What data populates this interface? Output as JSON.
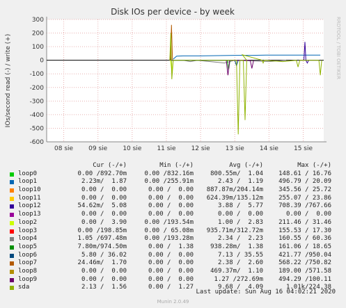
{
  "chart_data": {
    "type": "line",
    "title": "Disk IOs per device - by week",
    "ylabel": "IOs/second read (-) / write (+)",
    "side_label": "RRDTOOL / TOBI OETIKER",
    "ylim": [
      -600,
      300
    ],
    "yticks": [
      300,
      200,
      100,
      0,
      -100,
      -200,
      -300,
      -400,
      -500,
      -600
    ],
    "xlim": [
      0,
      8.1
    ],
    "xticks": [
      {
        "value": 0.5,
        "label": "08 sie"
      },
      {
        "value": 1.5,
        "label": "09 sie"
      },
      {
        "value": 2.5,
        "label": "10 sie"
      },
      {
        "value": 3.5,
        "label": "11 sie"
      },
      {
        "value": 4.5,
        "label": "12 sie"
      },
      {
        "value": 5.5,
        "label": "13 sie"
      },
      {
        "value": 6.5,
        "label": "14 sie"
      },
      {
        "value": 7.5,
        "label": "15 sie"
      }
    ],
    "grid": true,
    "series": [
      {
        "name": "loop0",
        "color": "#00cc00",
        "points": []
      },
      {
        "name": "loop1",
        "color": "#0066b3",
        "points": [
          [
            3.7,
            8
          ],
          [
            3.8,
            30
          ],
          [
            4.0,
            32
          ],
          [
            4.5,
            32
          ],
          [
            5.0,
            34
          ],
          [
            5.5,
            36
          ],
          [
            6.0,
            36
          ],
          [
            6.5,
            38
          ],
          [
            7.0,
            38
          ],
          [
            7.5,
            38
          ],
          [
            8.0,
            38
          ]
        ]
      },
      {
        "name": "loop10",
        "color": "#ff8000",
        "points": []
      },
      {
        "name": "loop11",
        "color": "#ffcc00",
        "points": []
      },
      {
        "name": "loop12",
        "color": "#330099",
        "points": [
          [
            7.52,
            0
          ],
          [
            7.55,
            135
          ],
          [
            7.58,
            0
          ],
          [
            7.62,
            -20
          ],
          [
            7.66,
            0
          ]
        ]
      },
      {
        "name": "loop13",
        "color": "#990099",
        "points": []
      },
      {
        "name": "loop2",
        "color": "#ccff00",
        "points": [
          [
            3.62,
            0
          ],
          [
            3.66,
            -80
          ],
          [
            3.7,
            0
          ]
        ]
      },
      {
        "name": "loop3",
        "color": "#ff0000",
        "points": []
      },
      {
        "name": "loop4",
        "color": "#808080",
        "points": [
          [
            4.0,
            0
          ],
          [
            4.2,
            -10
          ],
          [
            4.4,
            0
          ],
          [
            5.2,
            -20
          ],
          [
            5.5,
            0
          ],
          [
            6.5,
            -10
          ],
          [
            7.0,
            0
          ]
        ]
      },
      {
        "name": "loop5",
        "color": "#008f00",
        "points": [
          [
            5.28,
            0
          ],
          [
            5.32,
            -70
          ],
          [
            5.36,
            0
          ]
        ]
      },
      {
        "name": "loop6",
        "color": "#00487d",
        "points": [
          [
            3.6,
            0
          ],
          [
            3.62,
            30
          ],
          [
            3.64,
            0
          ],
          [
            5.5,
            0
          ],
          [
            5.55,
            -40
          ],
          [
            5.6,
            0
          ]
        ]
      },
      {
        "name": "loop7",
        "color": "#b35a00",
        "points": [
          [
            3.62,
            0
          ],
          [
            3.65,
            260
          ],
          [
            3.68,
            0
          ]
        ]
      },
      {
        "name": "loop8",
        "color": "#b38f00",
        "points": []
      },
      {
        "name": "loop9",
        "color": "#6b006b",
        "points": [
          [
            5.25,
            0
          ],
          [
            5.3,
            -110
          ],
          [
            5.35,
            0
          ],
          [
            5.95,
            0
          ],
          [
            6.0,
            -60
          ],
          [
            6.05,
            0
          ]
        ]
      },
      {
        "name": "sda",
        "color": "#8fb300",
        "points": [
          [
            3.6,
            0
          ],
          [
            3.63,
            200
          ],
          [
            3.66,
            -140
          ],
          [
            3.7,
            0
          ],
          [
            5.55,
            0
          ],
          [
            5.6,
            -545
          ],
          [
            5.65,
            0
          ],
          [
            5.75,
            0
          ],
          [
            5.8,
            -440
          ],
          [
            5.85,
            0
          ],
          [
            5.72,
            40
          ],
          [
            6.3,
            0
          ],
          [
            6.33,
            -20
          ],
          [
            6.36,
            0
          ],
          [
            6.9,
            -10
          ],
          [
            7.3,
            0
          ],
          [
            7.35,
            -50
          ],
          [
            7.4,
            0
          ],
          [
            7.96,
            0
          ],
          [
            8.0,
            -110
          ],
          [
            8.04,
            0
          ]
        ]
      }
    ],
    "legend_headers": [
      "Cur (-/+)",
      "Min (-/+)",
      "Avg (-/+)",
      "Max (-/+)"
    ],
    "legend": [
      {
        "name": "loop0",
        "cur": "0.00 /892.70m",
        "min": "0.00 /832.16m",
        "avg": "800.55m/  1.04",
        "max": "148.61 / 16.76"
      },
      {
        "name": "loop1",
        "cur": "2.23m/  1.87",
        "min": "0.00 /255.91m",
        "avg": "2.43 /  1.19",
        "max": "496.79 / 20.09"
      },
      {
        "name": "loop10",
        "cur": "0.00 /  0.00",
        "min": "0.00 /  0.00",
        "avg": "887.87m/204.14m",
        "max": "345.56 / 25.72"
      },
      {
        "name": "loop11",
        "cur": "0.00 /  0.00",
        "min": "0.00 /  0.00",
        "avg": "624.39m/135.12m",
        "max": "255.07 / 23.86"
      },
      {
        "name": "loop12",
        "cur": "54.62m/  5.08",
        "min": "0.00 /  0.00",
        "avg": "3.88 /  5.77",
        "max": "708.39 /767.66"
      },
      {
        "name": "loop13",
        "cur": "0.00 /  0.00",
        "min": "0.00 /  0.00",
        "avg": "0.00 /  0.00",
        "max": "0.00 /  0.00"
      },
      {
        "name": "loop2",
        "cur": "0.00 /  3.90",
        "min": "0.00 /193.54m",
        "avg": "1.00 /  2.83",
        "max": "211.46 / 31.46"
      },
      {
        "name": "loop3",
        "cur": "0.00 /198.85m",
        "min": "0.00 / 65.08m",
        "avg": "935.71m/312.72m",
        "max": "155.53 / 17.30"
      },
      {
        "name": "loop4",
        "cur": "1.05 /697.48m",
        "min": "0.00 /193.28m",
        "avg": "2.34 /  2.23",
        "max": "160.55 / 60.36"
      },
      {
        "name": "loop5",
        "cur": "7.80m/974.50m",
        "min": "0.00 /  1.38",
        "avg": "938.28m/  1.38",
        "max": "161.06 / 18.65"
      },
      {
        "name": "loop6",
        "cur": "5.80 / 36.02",
        "min": "0.00 /  0.00",
        "avg": "7.13 / 35.55",
        "max": "421.77 /950.04"
      },
      {
        "name": "loop7",
        "cur": "24.46m/  1.70",
        "min": "0.00 /  0.00",
        "avg": "2.38 /  2.60",
        "max": "568.22 /750.82"
      },
      {
        "name": "loop8",
        "cur": "0.00 /  0.00",
        "min": "0.00 /  0.00",
        "avg": "469.37m/  1.10",
        "max": "189.00 /571.58"
      },
      {
        "name": "loop9",
        "cur": "0.00 /  0.00",
        "min": "0.00 /  0.00",
        "avg": "1.27 /272.69m",
        "max": "494.29 /100.11"
      },
      {
        "name": "sda",
        "cur": "2.13 /  1.56",
        "min": "0.00 /  1.27",
        "avg": "9.68 /  4.09",
        "max": "1.01k/224.38"
      }
    ],
    "last_update": "Last update: Sun Aug 16 04:02:21 2020",
    "footer": "Munin 2.0.49"
  }
}
